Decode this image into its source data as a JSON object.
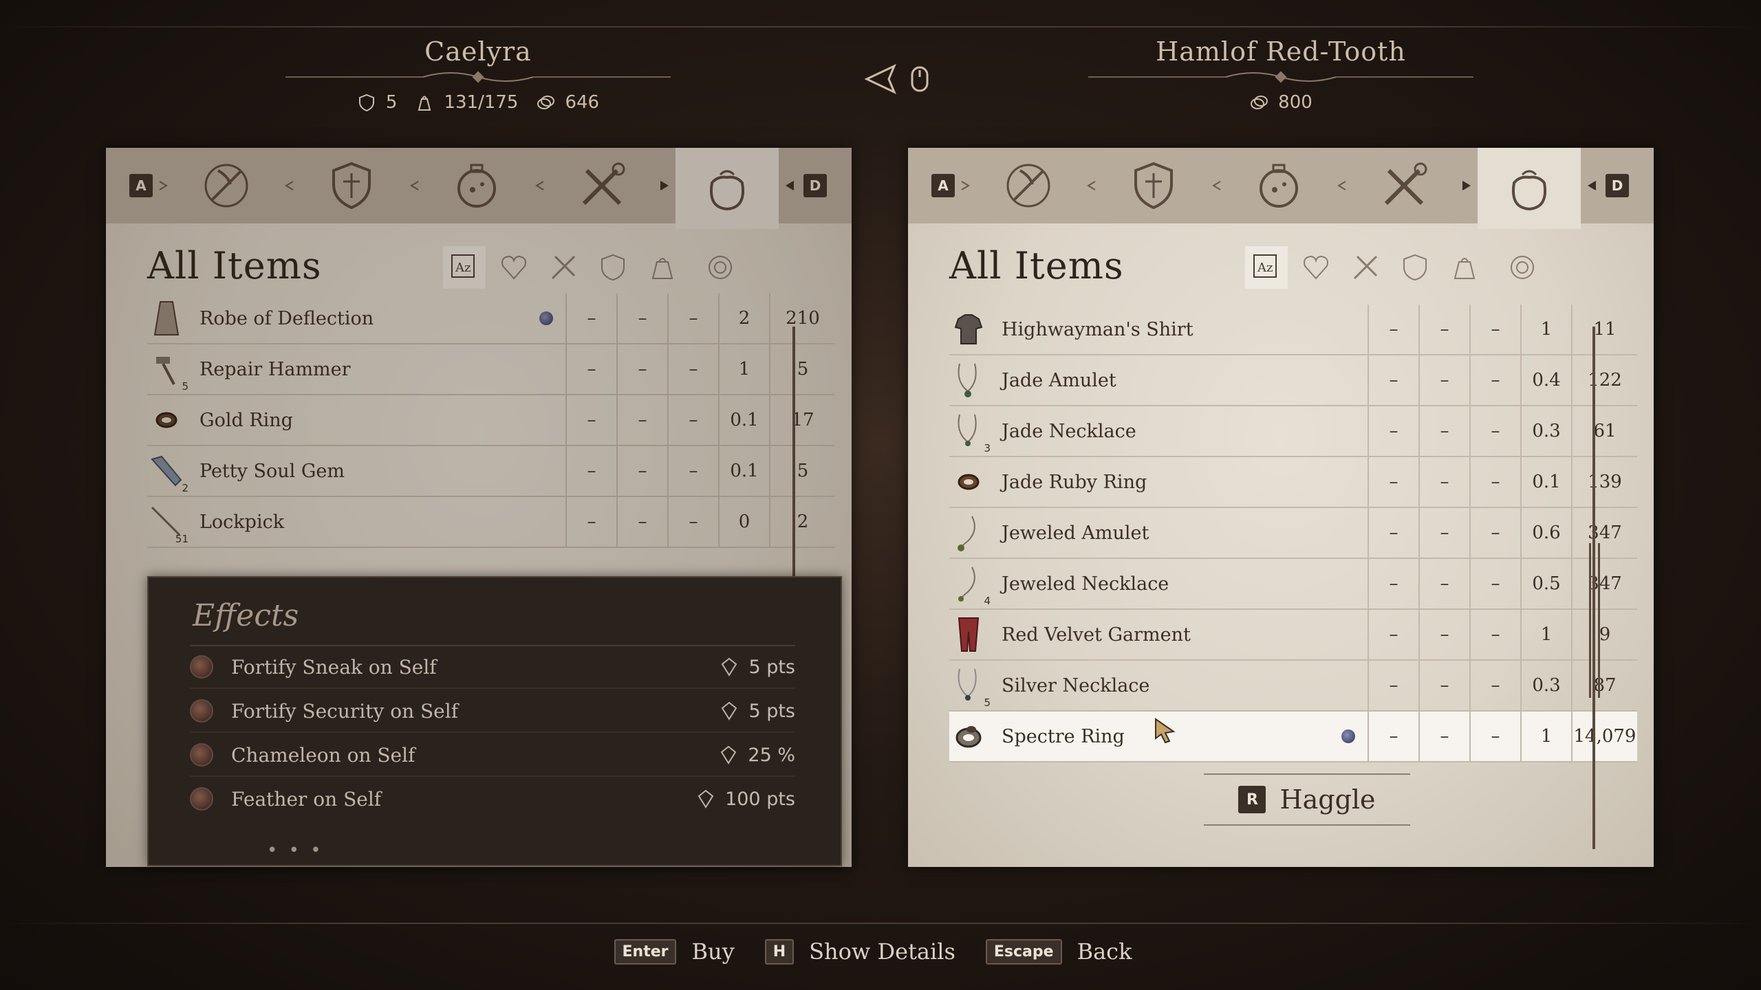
{
  "player": {
    "name": "Caelyra",
    "armor": "5",
    "encumbrance": "131/175",
    "gold": "646"
  },
  "merchant": {
    "name": "Hamlof Red-Tooth",
    "gold": "800"
  },
  "tab_keys": {
    "left": "A",
    "right": "D"
  },
  "tabs": [
    {
      "icon": "weapons-icon"
    },
    {
      "icon": "armor-icon"
    },
    {
      "icon": "alchemy-icon"
    },
    {
      "icon": "misc-tools-icon"
    },
    {
      "icon": "all-items-bag-icon",
      "active": true
    }
  ],
  "list_title": "All Items",
  "player_items": [
    {
      "name": "Robe of Deflection",
      "enchanted": true,
      "c1": "–",
      "c2": "–",
      "c3": "–",
      "weight": "2",
      "value": "210"
    },
    {
      "name": "Repair Hammer",
      "count": "5",
      "c1": "–",
      "c2": "–",
      "c3": "–",
      "weight": "1",
      "value": "5"
    },
    {
      "name": "Gold Ring",
      "c1": "–",
      "c2": "–",
      "c3": "–",
      "weight": "0.1",
      "value": "17"
    },
    {
      "name": "Petty Soul Gem",
      "count": "2",
      "c1": "–",
      "c2": "–",
      "c3": "–",
      "weight": "0.1",
      "value": "5"
    },
    {
      "name": "Lockpick",
      "count": "51",
      "c1": "–",
      "c2": "–",
      "c3": "–",
      "weight": "0",
      "value": "2"
    }
  ],
  "effects": {
    "title": "Effects",
    "rows": [
      {
        "name": "Fortify Sneak on Self",
        "value": "5 pts"
      },
      {
        "name": "Fortify Security on Self",
        "value": "5 pts"
      },
      {
        "name": "Chameleon on Self",
        "value": "25 %"
      },
      {
        "name": "Feather on Self",
        "value": "100 pts"
      }
    ],
    "more": "• • •"
  },
  "merchant_items": [
    {
      "name": "Highwayman's Shirt",
      "c1": "–",
      "c2": "–",
      "c3": "–",
      "weight": "1",
      "value": "11"
    },
    {
      "name": "Jade Amulet",
      "c1": "–",
      "c2": "–",
      "c3": "–",
      "weight": "0.4",
      "value": "122"
    },
    {
      "name": "Jade Necklace",
      "count": "3",
      "c1": "–",
      "c2": "–",
      "c3": "–",
      "weight": "0.3",
      "value": "61"
    },
    {
      "name": "Jade Ruby Ring",
      "c1": "–",
      "c2": "–",
      "c3": "–",
      "weight": "0.1",
      "value": "139"
    },
    {
      "name": "Jeweled Amulet",
      "c1": "–",
      "c2": "–",
      "c3": "–",
      "weight": "0.6",
      "value": "347"
    },
    {
      "name": "Jeweled Necklace",
      "count": "4",
      "c1": "–",
      "c2": "–",
      "c3": "–",
      "weight": "0.5",
      "value": "347"
    },
    {
      "name": "Red Velvet Garment",
      "c1": "–",
      "c2": "–",
      "c3": "–",
      "weight": "1",
      "value": "9"
    },
    {
      "name": "Silver Necklace",
      "count": "5",
      "c1": "–",
      "c2": "–",
      "c3": "–",
      "weight": "0.3",
      "value": "87"
    },
    {
      "name": "Spectre Ring",
      "enchanted": true,
      "selected": true,
      "c1": "–",
      "c2": "–",
      "c3": "–",
      "weight": "1",
      "value": "14,079"
    }
  ],
  "haggle": {
    "key": "R",
    "label": "Haggle"
  },
  "footer": [
    {
      "key": "Enter",
      "label": "Buy"
    },
    {
      "key": "H",
      "label": "Show Details"
    },
    {
      "key": "Escape",
      "label": "Back"
    }
  ]
}
